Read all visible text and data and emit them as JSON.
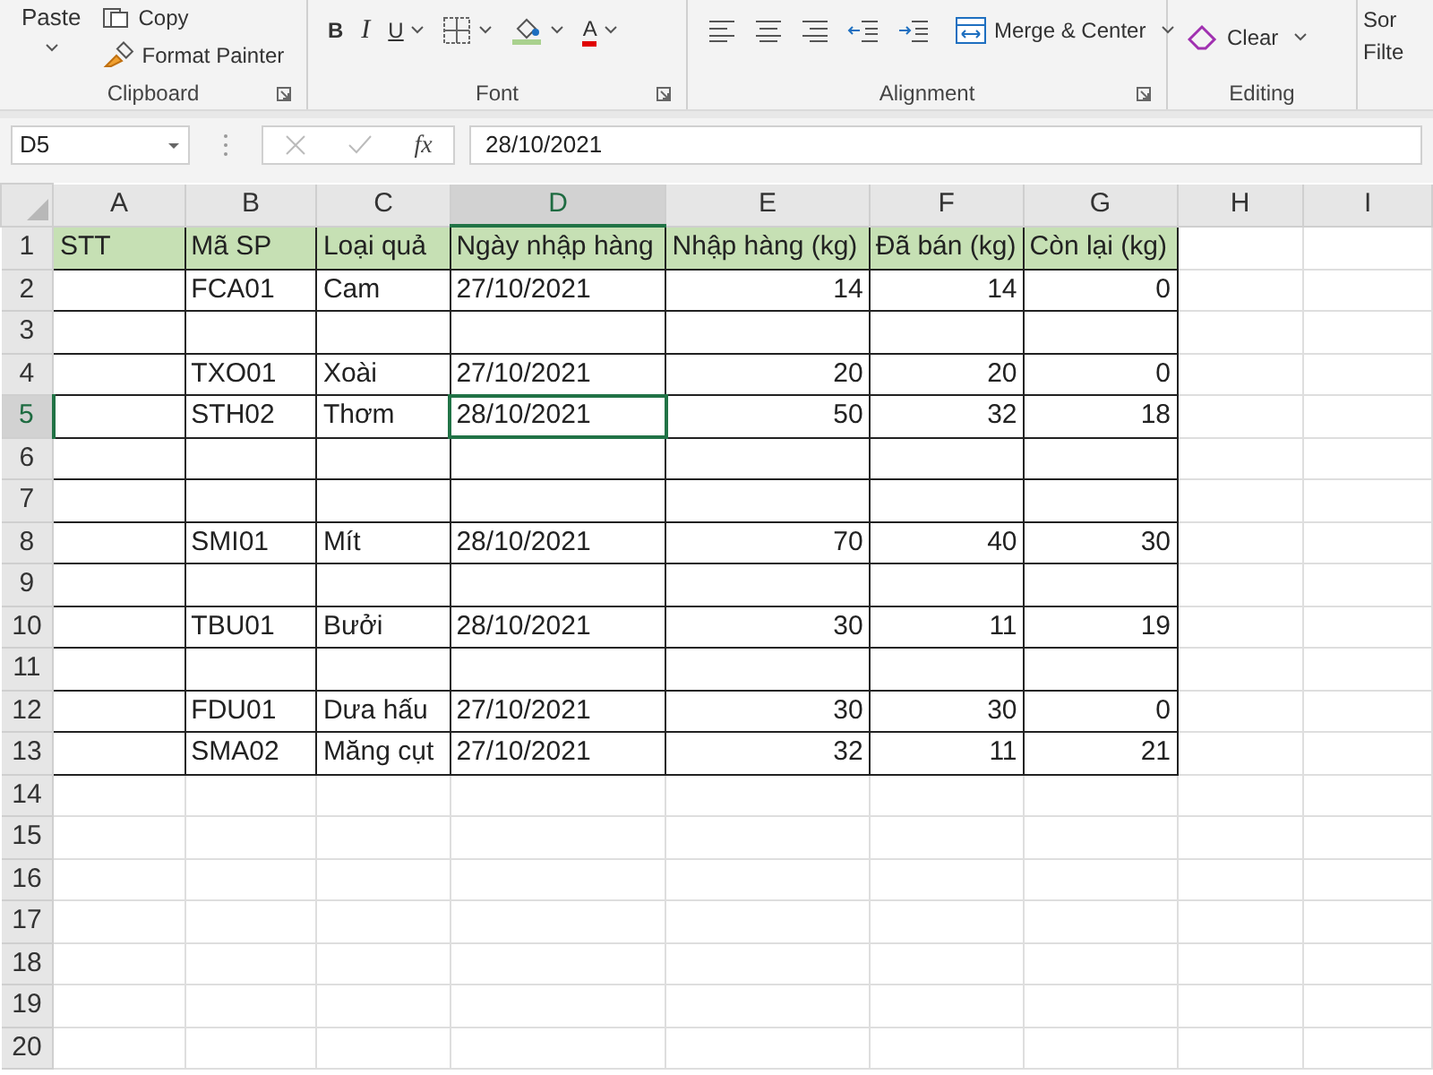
{
  "ribbon": {
    "groups": [
      {
        "label": "Clipboard",
        "items": [
          {
            "kind": "paste",
            "label": "Paste"
          },
          {
            "kind": "copy",
            "label": "Copy"
          },
          {
            "kind": "painter",
            "label": "Format Painter"
          }
        ]
      },
      {
        "label": "Font",
        "items": [
          {
            "kind": "bold",
            "label": "B"
          },
          {
            "kind": "italic",
            "label": "I"
          },
          {
            "kind": "underline",
            "label": "U"
          },
          {
            "kind": "borders"
          },
          {
            "kind": "fill"
          },
          {
            "kind": "fontcolor",
            "label": "A"
          }
        ]
      },
      {
        "label": "Alignment",
        "items": [
          {
            "kind": "left"
          },
          {
            "kind": "center"
          },
          {
            "kind": "right"
          },
          {
            "kind": "outdent"
          },
          {
            "kind": "indent"
          },
          {
            "kind": "merge",
            "label": "Merge & Center"
          }
        ]
      },
      {
        "label": "Editing",
        "items": [
          {
            "kind": "clear",
            "label": "Clear"
          }
        ]
      }
    ],
    "cut_texts": [
      "Sor",
      "Filte"
    ]
  },
  "formula_bar": {
    "name_box": "D5",
    "function_label": "fx",
    "value": "28/10/2021"
  },
  "table": {
    "columns": [
      {
        "letter": "A",
        "selected": false
      },
      {
        "letter": "B",
        "selected": false
      },
      {
        "letter": "C",
        "selected": false
      },
      {
        "letter": "D",
        "selected": true
      },
      {
        "letter": "E",
        "selected": false
      },
      {
        "letter": "F",
        "selected": false
      },
      {
        "letter": "G",
        "selected": false
      },
      {
        "letter": "H",
        "selected": false
      },
      {
        "letter": "I",
        "selected": false
      }
    ],
    "rows": [
      {
        "number": "1",
        "selected": false,
        "kind": "heading",
        "cells": [
          "STT",
          "Mã SP",
          "Loại quả",
          "Ngày nhập hàng",
          "Nhập hàng (kg)",
          "Đã bán (kg)",
          "Còn lại (kg)"
        ]
      },
      {
        "number": "2",
        "selected": false,
        "kind": "record",
        "cells": [
          "",
          "FCA01",
          "Cam",
          "27/10/2021",
          "14",
          "14",
          "0"
        ]
      },
      {
        "number": "3",
        "selected": false,
        "kind": "spacer"
      },
      {
        "number": "4",
        "selected": false,
        "kind": "record",
        "cells": [
          "",
          "TXO01",
          "Xoài",
          "27/10/2021",
          "20",
          "20",
          "0"
        ]
      },
      {
        "number": "5",
        "selected": true,
        "kind": "record",
        "cells": [
          "",
          "STH02",
          "Thơm",
          "28/10/2021",
          "50",
          "32",
          "18"
        ]
      },
      {
        "number": "6",
        "selected": false,
        "kind": "spacer"
      },
      {
        "number": "7",
        "selected": false,
        "kind": "spacer"
      },
      {
        "number": "8",
        "selected": false,
        "kind": "record",
        "cells": [
          "",
          "SMI01",
          "Mít",
          "28/10/2021",
          "70",
          "40",
          "30"
        ]
      },
      {
        "number": "9",
        "selected": false,
        "kind": "spacer"
      },
      {
        "number": "10",
        "selected": false,
        "kind": "record",
        "cells": [
          "",
          "TBU01",
          "Bưởi",
          "28/10/2021",
          "30",
          "11",
          "19"
        ]
      },
      {
        "number": "11",
        "selected": false,
        "kind": "spacer"
      },
      {
        "number": "12",
        "selected": false,
        "kind": "record",
        "cells": [
          "",
          "FDU01",
          "Dưa hấu",
          "27/10/2021",
          "30",
          "30",
          "0"
        ]
      },
      {
        "number": "13",
        "selected": false,
        "kind": "record",
        "cells": [
          "",
          "SMA02",
          "Măng cụt",
          "27/10/2021",
          "32",
          "11",
          "21"
        ]
      },
      {
        "number": "14",
        "selected": false,
        "kind": "empty"
      },
      {
        "number": "15",
        "selected": false,
        "kind": "empty"
      },
      {
        "number": "16",
        "selected": false,
        "kind": "empty"
      },
      {
        "number": "17",
        "selected": false,
        "kind": "empty"
      },
      {
        "number": "18",
        "selected": false,
        "kind": "empty"
      },
      {
        "number": "19",
        "selected": false,
        "kind": "empty"
      },
      {
        "number": "20",
        "selected": false,
        "kind": "empty"
      }
    ]
  }
}
